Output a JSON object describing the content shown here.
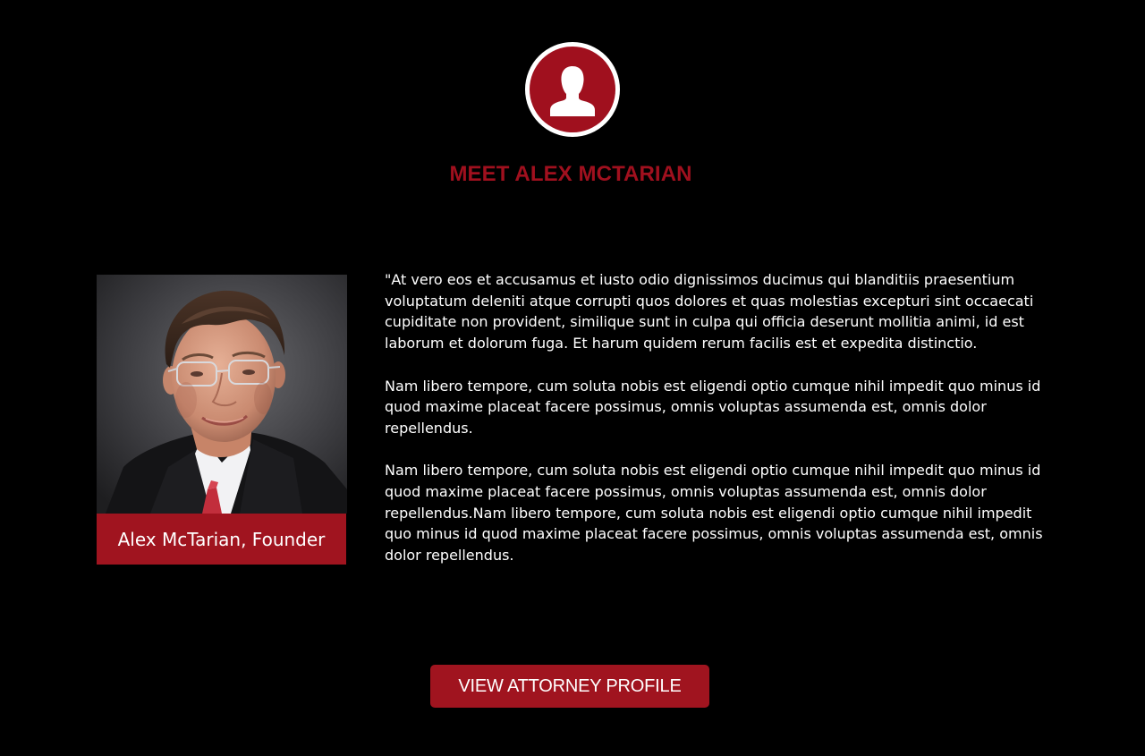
{
  "header": {
    "icon": "person-icon",
    "title": "MEET ALEX MCTARIAN"
  },
  "profile": {
    "photo": "founder-portrait",
    "caption": "Alex McTarian, Founder"
  },
  "bio": {
    "paragraphs": [
      "\"At vero eos et accusamus et iusto odio dignissimos ducimus qui blanditiis praesentium voluptatum deleniti atque corrupti quos dolores et quas molestias excepturi sint occaecati cupiditate non provident, similique sunt in culpa qui officia deserunt mollitia animi, id est laborum et dolorum fuga. Et harum quidem rerum facilis est et expedita distinctio.",
      "Nam libero tempore, cum soluta nobis est eligendi optio cumque nihil impedit quo minus id quod maxime placeat facere possimus, omnis voluptas assumenda est, omnis dolor repellendus.",
      "Nam libero tempore, cum soluta nobis est eligendi optio cumque nihil impedit quo minus id quod maxime placeat facere possimus, omnis voluptas assumenda est, omnis dolor repellendus.Nam libero tempore, cum soluta nobis est eligendi optio cumque nihil impedit quo minus id quod maxime placeat facere possimus, omnis voluptas assumenda est, omnis dolor repellendus."
    ]
  },
  "cta": {
    "label": "VIEW ATTORNEY PROFILE"
  },
  "colors": {
    "background": "#000000",
    "accent": "#a0101e",
    "text": "#ffffff"
  }
}
